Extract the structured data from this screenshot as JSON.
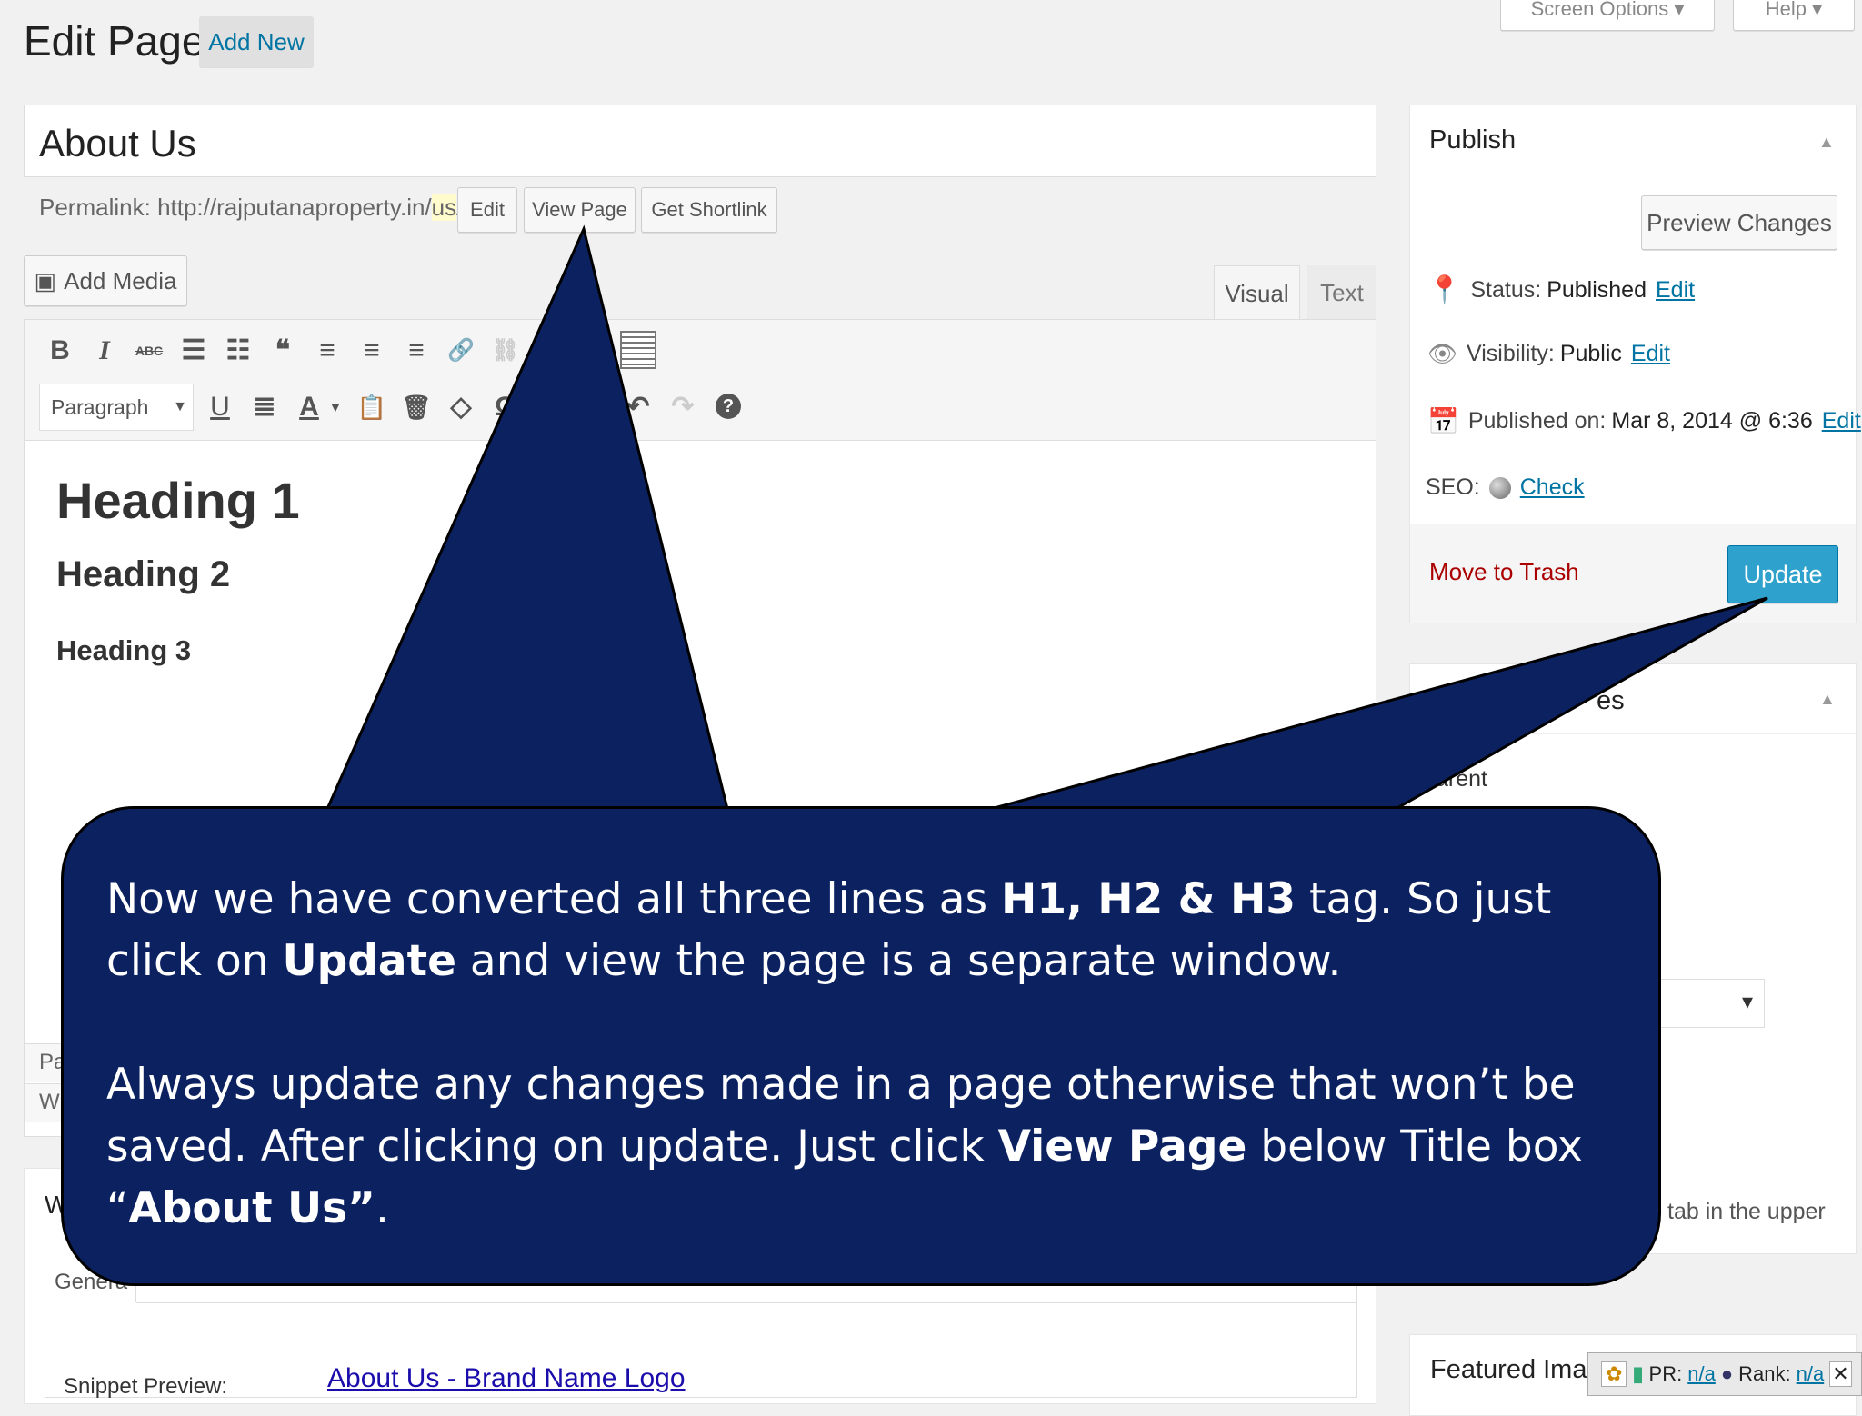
{
  "header": {
    "title": "Edit Page",
    "add_new": "Add New",
    "screen_options": "Screen Options ▾",
    "help": "Help ▾"
  },
  "post": {
    "title": "About Us",
    "permalink_label": "Permalink:",
    "permalink_url": "http://rajputanaproperty.in/",
    "permalink_slug": "us",
    "permalink_trail": "/",
    "edit_btn": "Edit",
    "view_page_btn": "View Page",
    "shortlink_btn": "Get Shortlink"
  },
  "editor": {
    "add_media": "Add Media",
    "tab_visual": "Visual",
    "tab_text": "Text",
    "format_select": "Paragraph",
    "toolbar1": [
      "B",
      "I",
      "ABC",
      "☰",
      "☷",
      "❝",
      "≡",
      "≡",
      "≡",
      "🔗",
      "⛓"
    ],
    "toolbar2": [
      "U",
      "≣",
      "A",
      "📋",
      "🗑",
      "◇",
      "Ω",
      "↶",
      "↷",
      "?"
    ],
    "h1": "Heading 1",
    "h2": "Heading 2",
    "h3": "Heading 3",
    "status_left1": "Pa",
    "status_left2": "W"
  },
  "publish": {
    "title": "Publish",
    "preview": "Preview Changes",
    "status_label": "Status:",
    "status_value": "Published",
    "visibility_label": "Visibility:",
    "visibility_value": "Public",
    "published_label": "Published on:",
    "published_value": "Mar 8, 2014 @ 6:36",
    "edit": "Edit",
    "seo_label": "SEO:",
    "seo_check": "Check",
    "trash": "Move to Trash",
    "update": "Update"
  },
  "attributes": {
    "title_fragment": "es",
    "parent_fragment": "arent",
    "select_arrow": "▾",
    "help_fragment": "tab in the upper"
  },
  "seo_box": {
    "title_fragment": "W",
    "tab_general": "Genera",
    "snippet_label": "Snippet Preview:",
    "snippet_title": "About Us - Brand Name Logo"
  },
  "featured": {
    "title": "Featured Imag"
  },
  "seo_toolbar": {
    "pr_label": "PR:",
    "pr_value": "n/a",
    "rank_label": "Rank:",
    "rank_value": "n/a"
  },
  "callout": {
    "p1_a": "Now we have converted all three lines as ",
    "p1_b": "H1, H2 & H3",
    "p1_c": " tag. So just click on ",
    "p1_d": "Update",
    "p1_e": " and view the page is a separate window.",
    "p2_a": "Always update any changes made in a page otherwise that won’t be saved. After clicking on update. Just click ",
    "p2_b": "View Page",
    "p2_c": " below Title box “",
    "p2_d": "About Us”",
    "p2_e": "."
  },
  "colors": {
    "callout_bg": "#0c2160",
    "update_bg": "#2ea2cc",
    "link": "#0074a2",
    "trash": "#a00"
  }
}
